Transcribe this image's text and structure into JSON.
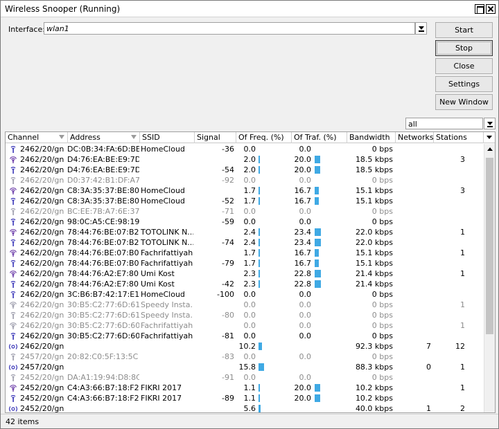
{
  "window": {
    "title": "Wireless Snooper (Running)"
  },
  "interface": {
    "label": "Interface:",
    "value": "wlan1"
  },
  "buttons": {
    "start": "Start",
    "stop": "Stop",
    "close": "Close",
    "settings": "Settings",
    "new_window": "New Window"
  },
  "filter": {
    "value": "all"
  },
  "columns": [
    "Channel",
    "Address",
    "SSID",
    "Signal",
    "Of Freq. (%)",
    "Of Traf. (%)",
    "Bandwidth",
    "Networks",
    "Stations"
  ],
  "rows": [
    {
      "icon": "ap",
      "dim": false,
      "channel": "2462/20/gn",
      "address": "DC:0B:34:FA:6D:BE",
      "ssid": "HomeCloud",
      "signal": "-36",
      "freq": "0.0",
      "freq_bar": 0,
      "traf": "0.0",
      "traf_bar": 0,
      "bandwidth": "0 bps",
      "networks": "",
      "stations": ""
    },
    {
      "icon": "sta",
      "dim": false,
      "channel": "2462/20/gn",
      "address": "D4:76:EA:BE:E9:7D",
      "ssid": "",
      "signal": "",
      "freq": "2.0",
      "freq_bar": 2.0,
      "traf": "20.0",
      "traf_bar": 20.0,
      "bandwidth": "18.5 kbps",
      "networks": "",
      "stations": "3"
    },
    {
      "icon": "ap",
      "dim": false,
      "channel": "2462/20/gn",
      "address": "D4:76:EA:BE:E9:7D",
      "ssid": "",
      "signal": "-54",
      "freq": "2.0",
      "freq_bar": 2.0,
      "traf": "20.0",
      "traf_bar": 20.0,
      "bandwidth": "18.5 kbps",
      "networks": "",
      "stations": ""
    },
    {
      "icon": "ap",
      "dim": true,
      "channel": "2462/20/gn",
      "address": "D0:37:42:B1:DF:A7",
      "ssid": "",
      "signal": "-92",
      "freq": "0.0",
      "freq_bar": 0,
      "traf": "0.0",
      "traf_bar": 0,
      "bandwidth": "0 bps",
      "networks": "",
      "stations": ""
    },
    {
      "icon": "sta",
      "dim": false,
      "channel": "2462/20/gn",
      "address": "C8:3A:35:37:BE:80",
      "ssid": "HomeCloud",
      "signal": "",
      "freq": "1.7",
      "freq_bar": 1.7,
      "traf": "16.7",
      "traf_bar": 16.7,
      "bandwidth": "15.1 kbps",
      "networks": "",
      "stations": "3"
    },
    {
      "icon": "ap",
      "dim": false,
      "channel": "2462/20/gn",
      "address": "C8:3A:35:37:BE:80",
      "ssid": "HomeCloud",
      "signal": "-52",
      "freq": "1.7",
      "freq_bar": 1.7,
      "traf": "16.7",
      "traf_bar": 16.7,
      "bandwidth": "15.1 kbps",
      "networks": "",
      "stations": ""
    },
    {
      "icon": "ap",
      "dim": true,
      "channel": "2462/20/gn",
      "address": "BC:EE:7B:A7:6E:37",
      "ssid": "",
      "signal": "-71",
      "freq": "0.0",
      "freq_bar": 0,
      "traf": "0.0",
      "traf_bar": 0,
      "bandwidth": "0 bps",
      "networks": "",
      "stations": ""
    },
    {
      "icon": "ap",
      "dim": false,
      "channel": "2462/20/gn",
      "address": "98:0C:A5:CE:98:19",
      "ssid": "",
      "signal": "-59",
      "freq": "0.0",
      "freq_bar": 0,
      "traf": "0.0",
      "traf_bar": 0,
      "bandwidth": "0 bps",
      "networks": "",
      "stations": ""
    },
    {
      "icon": "sta",
      "dim": false,
      "channel": "2462/20/gn",
      "address": "78:44:76:BE:07:B2",
      "ssid": "TOTOLINK N...",
      "signal": "",
      "freq": "2.4",
      "freq_bar": 2.4,
      "traf": "23.4",
      "traf_bar": 23.4,
      "bandwidth": "22.0 kbps",
      "networks": "",
      "stations": "1"
    },
    {
      "icon": "ap",
      "dim": false,
      "channel": "2462/20/gn",
      "address": "78:44:76:BE:07:B2",
      "ssid": "TOTOLINK N...",
      "signal": "-74",
      "freq": "2.4",
      "freq_bar": 2.4,
      "traf": "23.4",
      "traf_bar": 23.4,
      "bandwidth": "22.0 kbps",
      "networks": "",
      "stations": ""
    },
    {
      "icon": "sta",
      "dim": false,
      "channel": "2462/20/gn",
      "address": "78:44:76:BE:07:B0",
      "ssid": "Fachrifattiyah...",
      "signal": "",
      "freq": "1.7",
      "freq_bar": 1.7,
      "traf": "16.7",
      "traf_bar": 16.7,
      "bandwidth": "15.1 kbps",
      "networks": "",
      "stations": "1"
    },
    {
      "icon": "ap",
      "dim": false,
      "channel": "2462/20/gn",
      "address": "78:44:76:BE:07:B0",
      "ssid": "Fachrifattiyah...",
      "signal": "-79",
      "freq": "1.7",
      "freq_bar": 1.7,
      "traf": "16.7",
      "traf_bar": 16.7,
      "bandwidth": "15.1 kbps",
      "networks": "",
      "stations": ""
    },
    {
      "icon": "sta",
      "dim": false,
      "channel": "2462/20/gn",
      "address": "78:44:76:A2:E7:80",
      "ssid": "Umi Kost",
      "signal": "",
      "freq": "2.3",
      "freq_bar": 2.3,
      "traf": "22.8",
      "traf_bar": 22.8,
      "bandwidth": "21.4 kbps",
      "networks": "",
      "stations": "1"
    },
    {
      "icon": "ap",
      "dim": false,
      "channel": "2462/20/gn",
      "address": "78:44:76:A2:E7:80",
      "ssid": "Umi Kost",
      "signal": "-42",
      "freq": "2.3",
      "freq_bar": 2.3,
      "traf": "22.8",
      "traf_bar": 22.8,
      "bandwidth": "21.4 kbps",
      "networks": "",
      "stations": ""
    },
    {
      "icon": "ap",
      "dim": false,
      "channel": "2462/20/gn",
      "address": "3C:B6:B7:42:17:E1",
      "ssid": "HomeCloud",
      "signal": "-100",
      "freq": "0.0",
      "freq_bar": 0,
      "traf": "0.0",
      "traf_bar": 0,
      "bandwidth": "0 bps",
      "networks": "",
      "stations": ""
    },
    {
      "icon": "sta",
      "dim": true,
      "channel": "2462/20/gn",
      "address": "30:B5:C2:77:6D:61",
      "ssid": "Speedy Insta...",
      "signal": "",
      "freq": "0.0",
      "freq_bar": 0,
      "traf": "0.0",
      "traf_bar": 0,
      "bandwidth": "0 bps",
      "networks": "",
      "stations": "1"
    },
    {
      "icon": "ap",
      "dim": true,
      "channel": "2462/20/gn",
      "address": "30:B5:C2:77:6D:61",
      "ssid": "Speedy Insta...",
      "signal": "-80",
      "freq": "0.0",
      "freq_bar": 0,
      "traf": "0.0",
      "traf_bar": 0,
      "bandwidth": "0 bps",
      "networks": "",
      "stations": ""
    },
    {
      "icon": "sta",
      "dim": true,
      "channel": "2462/20/gn",
      "address": "30:B5:C2:77:6D:60",
      "ssid": "Fachrifattiyah...",
      "signal": "",
      "freq": "0.0",
      "freq_bar": 0,
      "traf": "0.0",
      "traf_bar": 0,
      "bandwidth": "0 bps",
      "networks": "",
      "stations": "1"
    },
    {
      "icon": "ap",
      "dim": false,
      "channel": "2462/20/gn",
      "address": "30:B5:C2:77:6D:60",
      "ssid": "Fachrifattiyah...",
      "signal": "-81",
      "freq": "0.0",
      "freq_bar": 0,
      "traf": "0.0",
      "traf_bar": 0,
      "bandwidth": "0 bps",
      "networks": "",
      "stations": ""
    },
    {
      "icon": "freq",
      "dim": false,
      "channel": "2462/20/gn",
      "address": "",
      "ssid": "",
      "signal": "",
      "freq": "10.2",
      "freq_bar": 10.2,
      "traf": "",
      "traf_bar": 0,
      "bandwidth": "92.3 kbps",
      "networks": "7",
      "stations": "12"
    },
    {
      "icon": "ap",
      "dim": true,
      "channel": "2457/20/gn",
      "address": "20:82:C0:5F:13:5C",
      "ssid": "",
      "signal": "-83",
      "freq": "0.0",
      "freq_bar": 0,
      "traf": "0.0",
      "traf_bar": 0,
      "bandwidth": "0 bps",
      "networks": "",
      "stations": ""
    },
    {
      "icon": "freq",
      "dim": false,
      "channel": "2457/20/gn",
      "address": "",
      "ssid": "",
      "signal": "",
      "freq": "15.8",
      "freq_bar": 15.8,
      "traf": "",
      "traf_bar": 0,
      "bandwidth": "88.3 kbps",
      "networks": "0",
      "stations": "1"
    },
    {
      "icon": "ap",
      "dim": true,
      "channel": "2452/20/gn",
      "address": "DA:A1:19:94:D8:8C",
      "ssid": "",
      "signal": "-91",
      "freq": "0.0",
      "freq_bar": 0,
      "traf": "0.0",
      "traf_bar": 0,
      "bandwidth": "0 bps",
      "networks": "",
      "stations": ""
    },
    {
      "icon": "sta",
      "dim": false,
      "channel": "2452/20/gn",
      "address": "C4:A3:66:B7:18:F2",
      "ssid": "FIKRI 2017",
      "signal": "",
      "freq": "1.1",
      "freq_bar": 1.1,
      "traf": "20.0",
      "traf_bar": 20.0,
      "bandwidth": "10.2 kbps",
      "networks": "",
      "stations": "1"
    },
    {
      "icon": "ap",
      "dim": false,
      "channel": "2452/20/gn",
      "address": "C4:A3:66:B7:18:F2",
      "ssid": "FIKRI 2017",
      "signal": "-89",
      "freq": "1.1",
      "freq_bar": 1.1,
      "traf": "20.0",
      "traf_bar": 20.0,
      "bandwidth": "10.2 kbps",
      "networks": "",
      "stations": ""
    },
    {
      "icon": "freq",
      "dim": false,
      "channel": "2452/20/gn",
      "address": "",
      "ssid": "",
      "signal": "",
      "freq": "5.6",
      "freq_bar": 5.6,
      "traf": "",
      "traf_bar": 0,
      "bandwidth": "40.0 kbps",
      "networks": "1",
      "stations": "2"
    }
  ],
  "status": {
    "items_count": "42 items"
  },
  "colors": {
    "bar": "#3fa9e4",
    "dim_text": "#8c8c8c",
    "ap_icon": "#3a36b8",
    "sta_icon": "#6a3aa8"
  }
}
